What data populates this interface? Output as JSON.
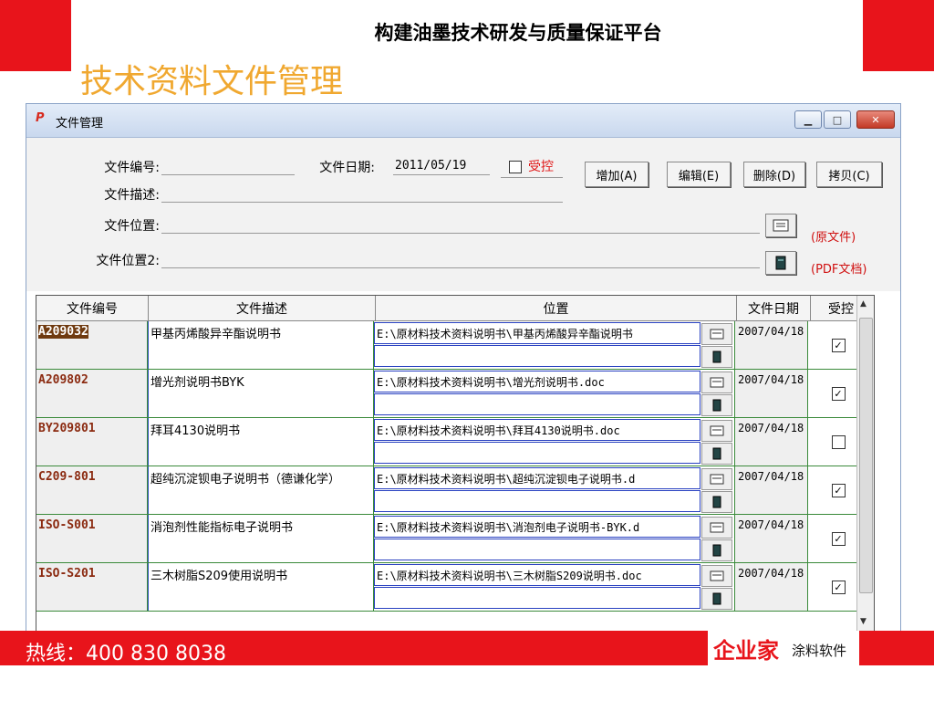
{
  "slide": {
    "top_title": "构建油墨技术研发与质量保证平台",
    "heading": "技术资料文件管理"
  },
  "window": {
    "icon_text": "P",
    "title": "文件管理",
    "min_glyph": "▁",
    "max_glyph": "□",
    "close_glyph": "✕"
  },
  "form": {
    "file_no_label": "文件编号:",
    "file_no_value": "",
    "file_date_label": "文件日期:",
    "file_date_value": "2011/05/19",
    "controlled_label": "受控",
    "desc_label": "文件描述:",
    "desc_value": "",
    "loc_label": "文件位置:",
    "loc_value": "",
    "loc2_label": "文件位置2:",
    "loc2_value": "",
    "original_note": "(原文件)",
    "pdf_note": "(PDF文档)",
    "buttons": {
      "add": "增加(A)",
      "edit": "编辑(E)",
      "delete": "删除(D)",
      "copy": "拷贝(C)"
    }
  },
  "grid": {
    "columns": [
      "文件编号",
      "文件描述",
      "位置",
      "文件日期",
      "受控"
    ],
    "rows": [
      {
        "no": "A209032",
        "desc": "甲基丙烯酸异辛酯说明书",
        "pos": "E:\\原材料技术资料说明书\\甲基丙烯酸异辛酯说明书",
        "date": "2007/04/18",
        "ctl": "✓"
      },
      {
        "no": "A209802",
        "desc": "增光剂说明书BYK",
        "pos": "E:\\原材料技术资料说明书\\增光剂说明书.doc",
        "date": "2007/04/18",
        "ctl": "✓"
      },
      {
        "no": "BY209801",
        "desc": "拜耳4130说明书",
        "pos": "E:\\原材料技术资料说明书\\拜耳4130说明书.doc",
        "date": "2007/04/18",
        "ctl": ""
      },
      {
        "no": "C209-801",
        "desc": "超纯沉淀钡电子说明书（德谦化学）",
        "pos": "E:\\原材料技术资料说明书\\超纯沉淀钡电子说明书.d",
        "date": "2007/04/18",
        "ctl": "✓"
      },
      {
        "no": "ISO-S001",
        "desc": "消泡剂性能指标电子说明书",
        "pos": "E:\\原材料技术资料说明书\\消泡剂电子说明书-BYK.d",
        "date": "2007/04/18",
        "ctl": "✓"
      },
      {
        "no": "ISO-S201",
        "desc": "三木树脂S209使用说明书",
        "pos": "E:\\原材料技术资料说明书\\三木树脂S209说明书.doc",
        "date": "2007/04/18",
        "ctl": "✓"
      }
    ],
    "scroll_up": "▲",
    "scroll_down": "▼"
  },
  "footer": {
    "hotline": "热线：400 830 8038",
    "logo_main": "企业家",
    "logo_sub": "涂料软件"
  },
  "colors": {
    "brand_red": "#e8141b",
    "heading_orange": "#f0a830"
  }
}
